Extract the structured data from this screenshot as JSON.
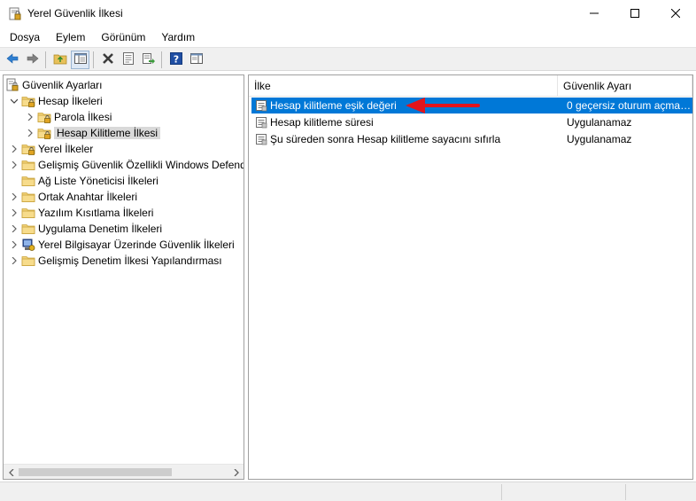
{
  "window": {
    "title": "Yerel Güvenlik İlkesi",
    "icon": "security-policy-icon",
    "controls": [
      "minimize-icon",
      "maximize-icon",
      "close-icon"
    ]
  },
  "menu": {
    "items": [
      "Dosya",
      "Eylem",
      "Görünüm",
      "Yardım"
    ]
  },
  "toolbar": {
    "buttons": [
      "back-icon",
      "forward-icon",
      "up-folder-icon",
      "show-hide-tree-icon",
      "delete-icon",
      "properties-icon",
      "export-list-icon",
      "help-icon",
      "show-hide-action-pane-icon"
    ]
  },
  "tree": {
    "items": [
      {
        "label": "Güvenlik Ayarları",
        "icon": "security-settings-icon",
        "level": 0,
        "expander": "none"
      },
      {
        "label": "Hesap İlkeleri",
        "icon": "folder-lock-icon",
        "level": 1,
        "expander": "expanded"
      },
      {
        "label": "Parola İlkesi",
        "icon": "folder-lock-icon",
        "level": 2,
        "expander": "collapsed"
      },
      {
        "label": "Hesap Kilitleme İlkesi",
        "icon": "folder-lock-icon",
        "level": 2,
        "expander": "collapsed",
        "selected": true
      },
      {
        "label": "Yerel İlkeler",
        "icon": "folder-lock-icon",
        "level": 1,
        "expander": "collapsed"
      },
      {
        "label": "Gelişmiş Güvenlik Özellikli Windows Defender",
        "icon": "folder-icon",
        "level": 1,
        "expander": "collapsed"
      },
      {
        "label": "Ağ Liste Yöneticisi İlkeleri",
        "icon": "folder-icon",
        "level": 1,
        "expander": "none"
      },
      {
        "label": "Ortak Anahtar İlkeleri",
        "icon": "folder-icon",
        "level": 1,
        "expander": "collapsed"
      },
      {
        "label": "Yazılım Kısıtlama İlkeleri",
        "icon": "folder-icon",
        "level": 1,
        "expander": "collapsed"
      },
      {
        "label": "Uygulama Denetim İlkeleri",
        "icon": "folder-icon",
        "level": 1,
        "expander": "collapsed"
      },
      {
        "label": "Yerel Bilgisayar Üzerinde Güvenlik İlkeleri",
        "icon": "ip-security-icon",
        "level": 1,
        "expander": "collapsed"
      },
      {
        "label": "Gelişmiş Denetim İlkesi Yapılandırması",
        "icon": "folder-icon",
        "level": 1,
        "expander": "collapsed"
      }
    ]
  },
  "list": {
    "columns": [
      "İlke",
      "Güvenlik Ayarı"
    ],
    "rows": [
      {
        "name": "Hesap kilitleme eşik değeri",
        "value": "0 geçersiz oturum açma ...",
        "selected": true
      },
      {
        "name": "Hesap kilitleme süresi",
        "value": "Uygulanamaz",
        "selected": false
      },
      {
        "name": "Şu süreden sonra Hesap kilitleme sayacını sıfırla",
        "value": "Uygulanamaz",
        "selected": false
      }
    ]
  },
  "colors": {
    "selection": "#0078d7",
    "annotation_arrow": "#e3141c",
    "tree_selection": "#d9d9d9"
  }
}
